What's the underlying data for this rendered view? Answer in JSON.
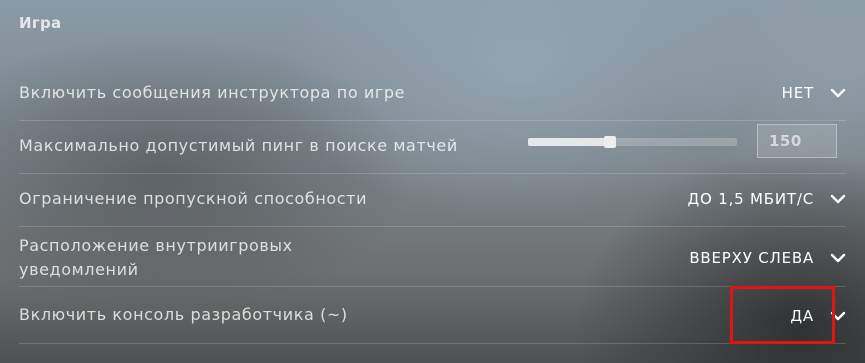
{
  "section": {
    "title": "Игра"
  },
  "rows": [
    {
      "label": "Включить сообщения инструктора по игре",
      "value": "НЕТ"
    },
    {
      "label": "Максимально допустимый пинг в поиске матчей",
      "slider_fraction": 0.39,
      "input_value": "150"
    },
    {
      "label": "Ограничение пропускной способности",
      "value": "ДО 1,5 МБИТ/С"
    },
    {
      "label_line1": "Расположение внутриигровых",
      "label_line2": "уведомлений",
      "value": "ВВЕРХУ СЛЕВА"
    },
    {
      "label": "Включить консоль разработчика (~)",
      "value": "ДА"
    }
  ],
  "icons": {
    "dropdown": "chevron-down-icon"
  },
  "colors": {
    "highlight": "#e11414",
    "text": "#ffffff"
  }
}
